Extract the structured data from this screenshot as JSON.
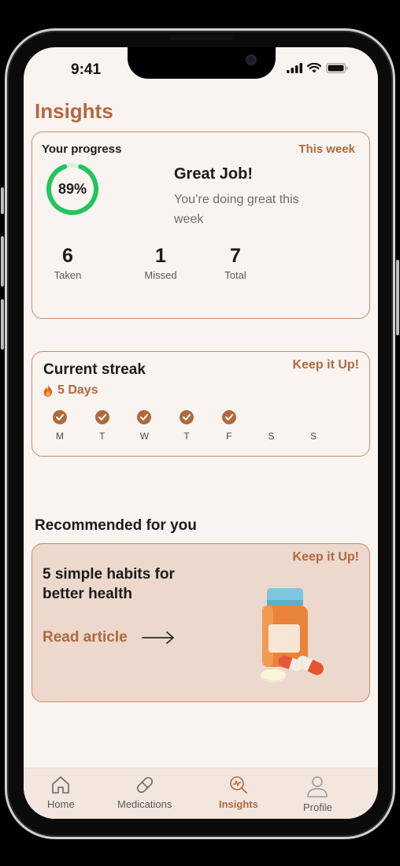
{
  "status": {
    "time": "9:41"
  },
  "page": {
    "title": "Insights"
  },
  "progress": {
    "title": "Your progress",
    "period": "This week",
    "percent": "89%",
    "percent_value": 0.89,
    "headline": "Great Job!",
    "subtext": "You’re doing great this week",
    "stats": [
      {
        "value": "6",
        "label": "Taken"
      },
      {
        "value": "1",
        "label": "Missed"
      },
      {
        "value": "7",
        "label": "Total"
      }
    ]
  },
  "streak": {
    "title": "Current streak",
    "badge": "Keep it Up!",
    "days_text": "5 Days",
    "days": [
      {
        "label": "M",
        "done": true
      },
      {
        "label": "T",
        "done": true
      },
      {
        "label": "W",
        "done": true
      },
      {
        "label": "T",
        "done": true
      },
      {
        "label": "F",
        "done": true
      },
      {
        "label": "S",
        "done": false
      },
      {
        "label": "S",
        "done": false
      }
    ]
  },
  "recommended": {
    "heading": "Recommended for you",
    "badge": "Keep it Up!",
    "title": "5 simple habits for better health",
    "link": "Read article"
  },
  "tabs": [
    {
      "label": "Home",
      "icon": "home-icon"
    },
    {
      "label": "Medications",
      "icon": "pill-icon"
    },
    {
      "label": "Insights",
      "icon": "insights-icon",
      "active": true
    },
    {
      "label": "Profile",
      "icon": "profile-icon"
    }
  ],
  "colors": {
    "accent": "#b0693d",
    "ring": "#22c55e",
    "background": "#faf4f1",
    "card_tint": "#ecd8cc"
  }
}
